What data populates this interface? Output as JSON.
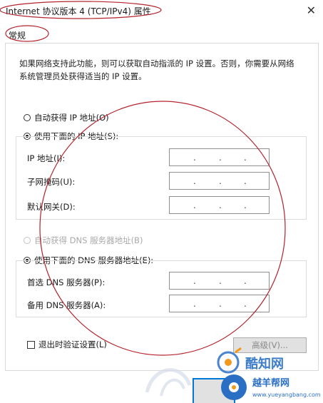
{
  "window": {
    "title": "Internet 协议版本 4 (TCP/IPv4) 属性",
    "close_glyph": "✕"
  },
  "tab": {
    "label": "常规"
  },
  "description": "如果网络支持此功能，则可以获取自动指派的 IP 设置。否则，你需要从网络系统管理员处获得适当的 IP 设置。",
  "ip_section": {
    "auto_label": "自动获得 IP 地址(O)",
    "auto_selected": false,
    "manual_label": "使用下面的 IP 地址(S):",
    "manual_selected": true,
    "fields": [
      {
        "label": "IP 地址(I):",
        "value": ". . ."
      },
      {
        "label": "子网掩码(U):",
        "value": ". . ."
      },
      {
        "label": "默认网关(D):",
        "value": ". . ."
      }
    ]
  },
  "dns_section": {
    "auto_label": "自动获得 DNS 服务器地址(B)",
    "auto_selected": false,
    "auto_disabled": true,
    "manual_label": "使用下面的 DNS 服务器地址(E):",
    "manual_selected": true,
    "fields": [
      {
        "label": "首选 DNS 服务器(P):",
        "value": ". . ."
      },
      {
        "label": "备用 DNS 服务器(A):",
        "value": ". . ."
      }
    ]
  },
  "validate_on_exit": {
    "label": "退出时验证设置(L)",
    "checked": false
  },
  "advanced_button": {
    "label": "高级(V)..."
  },
  "watermark": {
    "brand": "酷知网",
    "site_name": "越羊帮网",
    "site_url": "www.yueyangbang.com"
  },
  "colors": {
    "annotation_red": "#b4232d",
    "focus_blue": "#0078d7",
    "watermark_blue": "#2a6fc4",
    "watermark_orange": "#f29a1b"
  }
}
